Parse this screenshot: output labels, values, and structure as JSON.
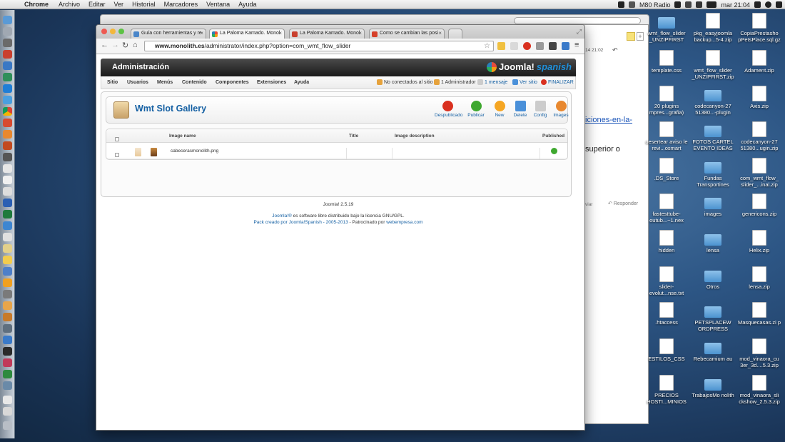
{
  "menubar": {
    "app": "Chrome",
    "items": [
      "Archivo",
      "Editar",
      "Ver",
      "Historial",
      "Marcadores",
      "Ventana",
      "Ayuda"
    ],
    "radio": "M80 Radio",
    "clock": "mar 21:04"
  },
  "browser": {
    "tabs": [
      {
        "label": "Guía con herramientas y re"
      },
      {
        "label": "La Paloma Kamado. Monol"
      },
      {
        "label": "La Paloma Kamado. Monol"
      },
      {
        "label": "Como se cambian las posi"
      }
    ],
    "url_host": "www.monolith.es",
    "url_path": "/administrator/index.php?option=com_wmt_flow_slider"
  },
  "joomla": {
    "header_title": "Administración",
    "logo_text": "Joomla!",
    "logo_suffix": "spanish",
    "menu": [
      "Sitio",
      "Usuarios",
      "Menús",
      "Contenido",
      "Componentes",
      "Extensiones",
      "Ayuda"
    ],
    "status": {
      "visitors": "No conectados al sitio",
      "admins": "1 Administrador",
      "messages": "1 mensaje",
      "view_site": "Ver sitio",
      "logout": "FINALIZAR"
    },
    "page_title": "Wmt Slot Gallery",
    "toolbar": [
      "Despublicado",
      "Publicar",
      "New",
      "Delete",
      "Config",
      "Images"
    ],
    "table": {
      "columns": [
        "Image name",
        "Title",
        "Image description",
        "Published"
      ],
      "rows": [
        {
          "image_name": "cabecerasmonolith.png",
          "title": "",
          "description": "",
          "published": true
        }
      ]
    },
    "version": "Joomla! 2.5.19",
    "footer_line1_link": "Joomla!®",
    "footer_line1_text": " es software libre distribuido bajo la licencia GNU/GPL.",
    "footer_line2_link": "Pack creado por Joomla!Spanish - 2005-2013",
    "footer_line2_text": " - Patrocinado por ",
    "footer_line2_link2": "webempresa.com"
  },
  "right_window": {
    "date": "14 21:02",
    "link": "iciones-en-la-",
    "text": "superior o",
    "reply_prev": "viar",
    "reply": "Responder"
  },
  "desktop": {
    "icons": [
      {
        "label": "wmt_flow_slider _UNZIPFIRST",
        "kind": "folder"
      },
      {
        "label": "pkg_easyjoomla backup...5-4.zip",
        "kind": "file"
      },
      {
        "label": "CopiaPrestasho pPetsPlace.sql.gz",
        "kind": "file"
      },
      {
        "label": "template.css",
        "kind": "file"
      },
      {
        "label": "wmt_flow_slider _UNZIPFIRST.zip",
        "kind": "file"
      },
      {
        "label": "Adament.zip",
        "kind": "file"
      },
      {
        "label": "20 plugins mpres...grafia)",
        "kind": "file"
      },
      {
        "label": "codecanyon-27 51380...-plugin",
        "kind": "folder"
      },
      {
        "label": "Axis.zip",
        "kind": "file"
      },
      {
        "label": "desertear aviso le revi...osmart",
        "kind": "file"
      },
      {
        "label": "FOTOS CARTEL EVENTO IDEAS",
        "kind": "folder"
      },
      {
        "label": "codecanyon-27 51380...ugin.zip",
        "kind": "file"
      },
      {
        "label": ".DS_Store",
        "kind": "file"
      },
      {
        "label": "Fundas Transportines",
        "kind": "folder"
      },
      {
        "label": "com_wmt_flow_ slider_...inal.zip",
        "kind": "file"
      },
      {
        "label": "fastesttube- outub...~1.nex",
        "kind": "file"
      },
      {
        "label": "images",
        "kind": "folder"
      },
      {
        "label": "genericons.zip",
        "kind": "file"
      },
      {
        "label": "hidden",
        "kind": "file"
      },
      {
        "label": "lensa",
        "kind": "folder"
      },
      {
        "label": "Helix.zip",
        "kind": "file"
      },
      {
        "label": "slider- evolut...nse.txt",
        "kind": "file"
      },
      {
        "label": "Otros",
        "kind": "folder"
      },
      {
        "label": "lensa.zip",
        "kind": "file"
      },
      {
        "label": ".htaccess",
        "kind": "file"
      },
      {
        "label": "PETSPLACEW ORDPRESS",
        "kind": "folder"
      },
      {
        "label": "Masquecasas.zi p",
        "kind": "file"
      },
      {
        "label": "ESTILOS_CSS",
        "kind": "file"
      },
      {
        "label": "Rebecamium au",
        "kind": "folder"
      },
      {
        "label": "mod_vinaora_cu 3er_3d....5.3.zip",
        "kind": "file"
      },
      {
        "label": "PRECIOS HOSTI...MINIOS",
        "kind": "file"
      },
      {
        "label": "TrabajosMo nolith",
        "kind": "folder"
      },
      {
        "label": "mod_vinaora_sli ckshow_2.5.3.zip",
        "kind": "file"
      }
    ]
  },
  "colors": {
    "joomla_blue": "#1560a3",
    "published_green": "#3ea82f",
    "unpublish_red": "#d9301f",
    "new_orange": "#f5a623"
  }
}
